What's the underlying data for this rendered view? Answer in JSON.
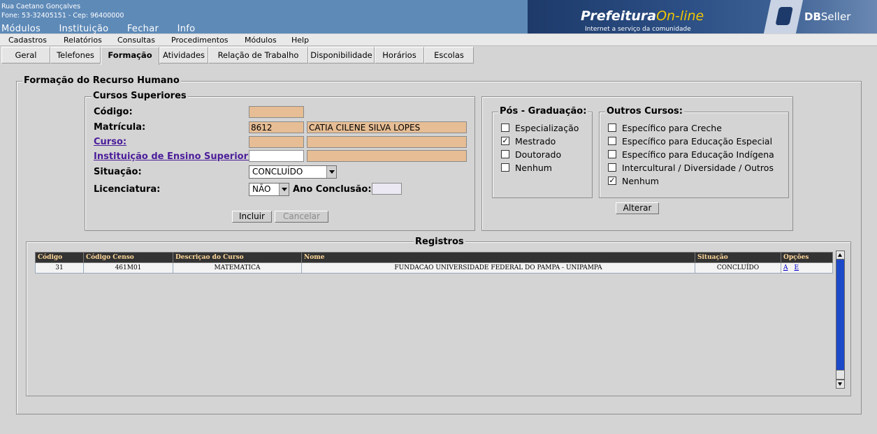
{
  "header": {
    "address_line": "Rua Caetano Gonçalves",
    "phone_line": "Fone: 53-32405151  -  Cep: 96400000",
    "main_menu": [
      "Módulos",
      "Instituição",
      "Fechar",
      "Info"
    ],
    "brand_main": "Prefeitura",
    "brand_online": "On-line",
    "brand_sub": "Internet a serviço da comunidade",
    "vendor_bold": "DB",
    "vendor_rest": "Seller"
  },
  "menubar": [
    "Cadastros",
    "Relatórios",
    "Consultas",
    "Procedimentos",
    "Módulos",
    "Help"
  ],
  "tabs": [
    "Geral",
    "Telefones",
    "Formação",
    "Atividades",
    "Relação de Trabalho",
    "Disponibilidade",
    "Horários",
    "Escolas"
  ],
  "active_tab": "Formação",
  "form": {
    "legend": "Formação do Recurso Humano",
    "cursos_legend": "Cursos Superiores",
    "codigo_label": "Código:",
    "codigo_value": "",
    "matricula_label": "Matrícula:",
    "matricula_value": "8612",
    "matricula_nome": "CATIA CILENE SILVA LOPES",
    "curso_label": "Curso:",
    "curso_code": "",
    "curso_name": "",
    "instituicao_label": "Instituição de Ensino Superior:",
    "instituicao_code": "",
    "instituicao_name": "",
    "situacao_label": "Situação:",
    "situacao_value": "CONCLUÍDO",
    "licenciatura_label": "Licenciatura:",
    "licenciatura_value": "NÃO",
    "ano_label": "Ano Conclusão:",
    "ano_value": "",
    "incluir_label": "Incluir",
    "cancelar_label": "Cancelar"
  },
  "pos": {
    "legend": "Pós - Graduação:",
    "items": [
      {
        "label": "Especialização",
        "checked": false
      },
      {
        "label": "Mestrado",
        "checked": true
      },
      {
        "label": "Doutorado",
        "checked": false
      },
      {
        "label": "Nenhum",
        "checked": false
      }
    ]
  },
  "outros": {
    "legend": "Outros Cursos:",
    "items": [
      {
        "label": "Específico para Creche",
        "checked": false
      },
      {
        "label": "Específico para Educação Especial",
        "checked": false
      },
      {
        "label": "Específico para Educação Indígena",
        "checked": false
      },
      {
        "label": "Intercultural / Diversidade / Outros",
        "checked": false
      },
      {
        "label": "Nenhum",
        "checked": true
      }
    ]
  },
  "alterar_label": "Alterar",
  "registros": {
    "legend": "Registros",
    "columns": [
      "Código",
      "Código Censo",
      "Descriçao do Curso",
      "Nome",
      "Situação",
      "Opções"
    ],
    "rows": [
      {
        "codigo": "31",
        "censo": "461M01",
        "curso": "MATEMATICA",
        "nome": "FUNDACAO UNIVERSIDADE FEDERAL DO PAMPA - UNIPAMPA",
        "situacao": "CONCLUÍDO",
        "opt_a": "A",
        "opt_e": "E"
      }
    ]
  }
}
